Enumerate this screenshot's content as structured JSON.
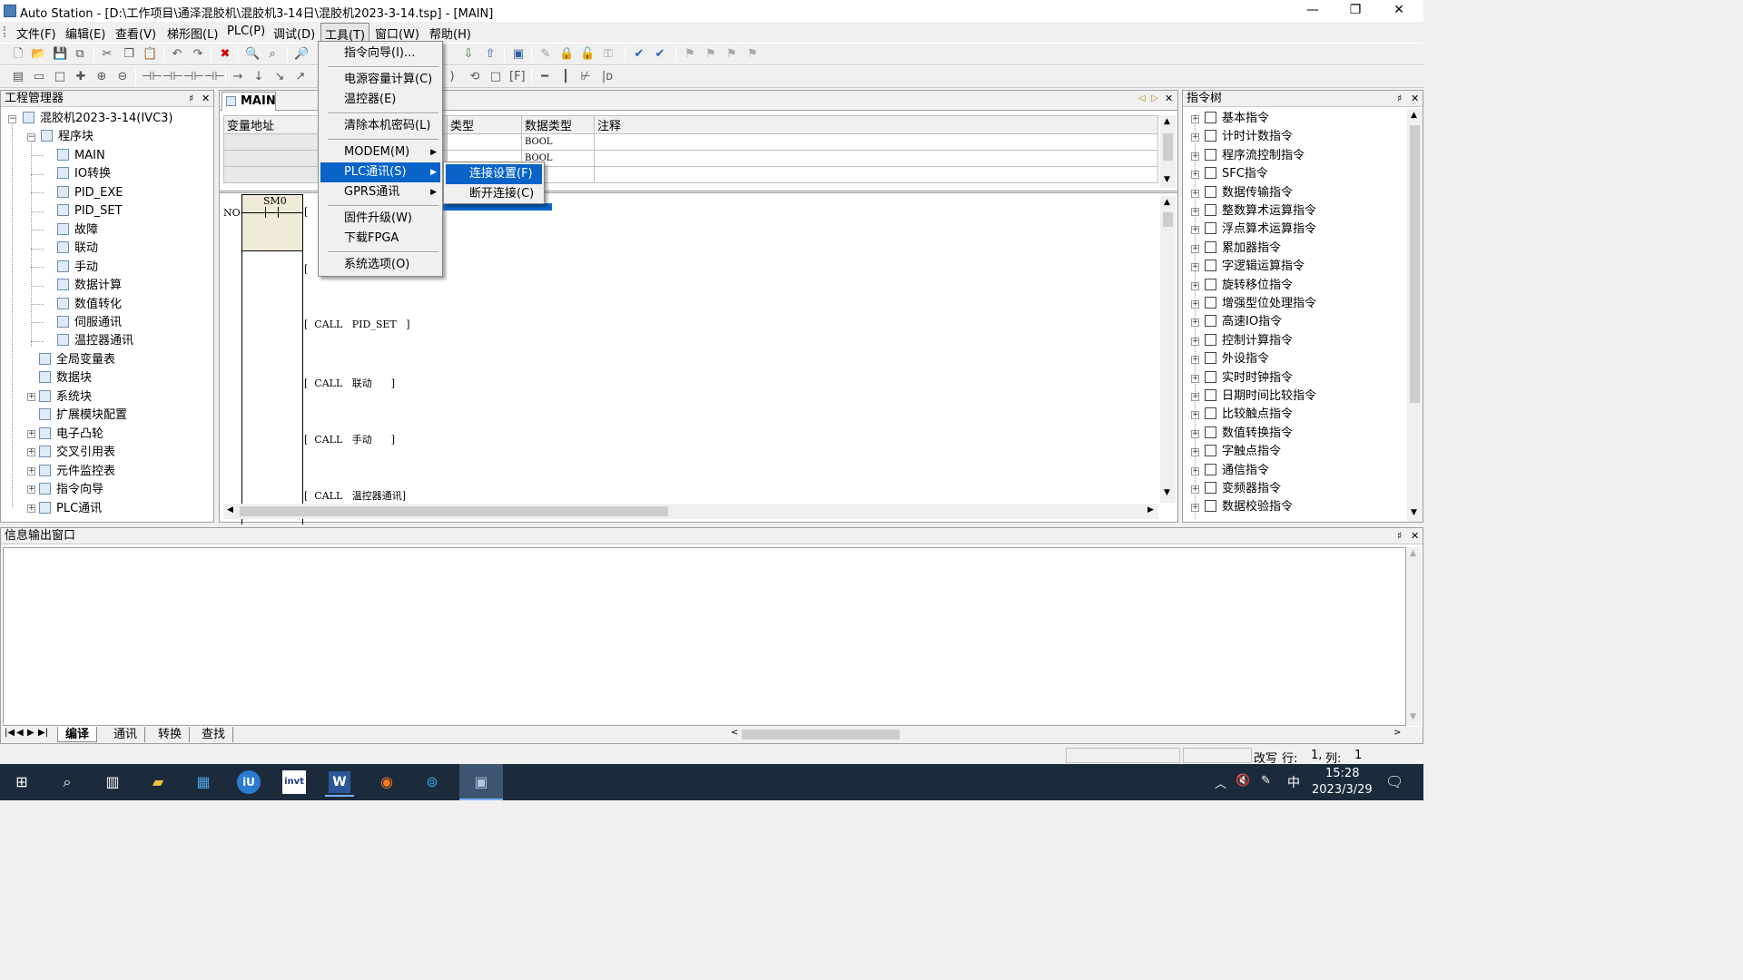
{
  "window": {
    "title": "Auto Station - [D:\\工作项目\\通泽混胶机\\混胶机3-14日\\混胶机2023-3-14.tsp] - [MAIN]",
    "minimize": "—",
    "restore": "❐",
    "close": "✕"
  },
  "menubar": [
    "文件(F)",
    "编辑(E)",
    "查看(V)",
    "梯形图(L)",
    "PLC(P)",
    "调试(D)",
    "工具(T)",
    "窗口(W)",
    "帮助(H)"
  ],
  "tools_menu": {
    "items": [
      "指令向导(I)...",
      "电源容量计算(C)",
      "温控器(E)",
      "清除本机密码(L)",
      "MODEM(M)",
      "PLC通讯(S)",
      "GPRS通讯",
      "固件升级(W)",
      "下载FPGA",
      "系统选项(O)"
    ]
  },
  "plc_submenu": {
    "items": [
      "连接设置(F)",
      "断开连接(C)"
    ]
  },
  "project_panel": {
    "title": "工程管理器",
    "pin": "♯",
    "close": "✕",
    "tree": {
      "root": "混胶机2023-3-14(IVC3)",
      "program_block": "程序块",
      "programs": [
        "MAIN",
        "IO转换",
        "PID_EXE",
        "PID_SET",
        "故障",
        "联动",
        "手动",
        "数据计算",
        "数值转化",
        "伺服通讯",
        "温控器通讯"
      ],
      "others": [
        "全局变量表",
        "数据块",
        "系统块",
        "扩展模块配置",
        "电子凸轮",
        "交叉引用表",
        "元件监控表",
        "指令向导",
        "PLC通讯"
      ]
    }
  },
  "editor": {
    "tab": "MAIN",
    "var_headers": [
      "变量地址",
      "类型",
      "数据类型",
      "注释"
    ],
    "var_rows": [
      [
        "",
        "",
        "BOOL",
        ""
      ],
      [
        "",
        "",
        "BOOL",
        ""
      ]
    ],
    "ladder": {
      "rung_label": "NO",
      "contact": "SM0",
      "calls": [
        {
          "kw": "CALL",
          "name": "PID_SET"
        },
        {
          "kw": "CALL",
          "name": "联动"
        },
        {
          "kw": "CALL",
          "name": "手动"
        },
        {
          "kw": "CALL",
          "name": "温控器通讯"
        }
      ]
    }
  },
  "instr_panel": {
    "title": "指令树",
    "items": [
      "基本指令",
      "计时计数指令",
      "程序流控制指令",
      "SFC指令",
      "数据传输指令",
      "整数算术运算指令",
      "浮点算术运算指令",
      "累加器指令",
      "字逻辑运算指令",
      "旋转移位指令",
      "增强型位处理指令",
      "高速IO指令",
      "控制计算指令",
      "外设指令",
      "实时时钟指令",
      "日期时间比较指令",
      "比较触点指令",
      "数值转换指令",
      "字触点指令",
      "通信指令",
      "变频器指令",
      "数据校验指令"
    ]
  },
  "output_panel": {
    "title": "信息输出窗口",
    "tabs": [
      "编译",
      "通讯",
      "转换",
      "查找"
    ]
  },
  "statusbar": {
    "mode": "改写",
    "row_label": "行:",
    "row": "1,",
    "col_label": "列:",
    "col": "1"
  },
  "taskbar": {
    "time": "15:28",
    "date": "2023/3/29",
    "ime": "中",
    "apps": [
      "windows-start",
      "search",
      "task-view",
      "file-explorer",
      "calculator",
      "invt-app",
      "invt-logo",
      "word",
      "firefox",
      "browser",
      "autostation"
    ],
    "invt_text": "invt",
    "word_text": "W"
  }
}
